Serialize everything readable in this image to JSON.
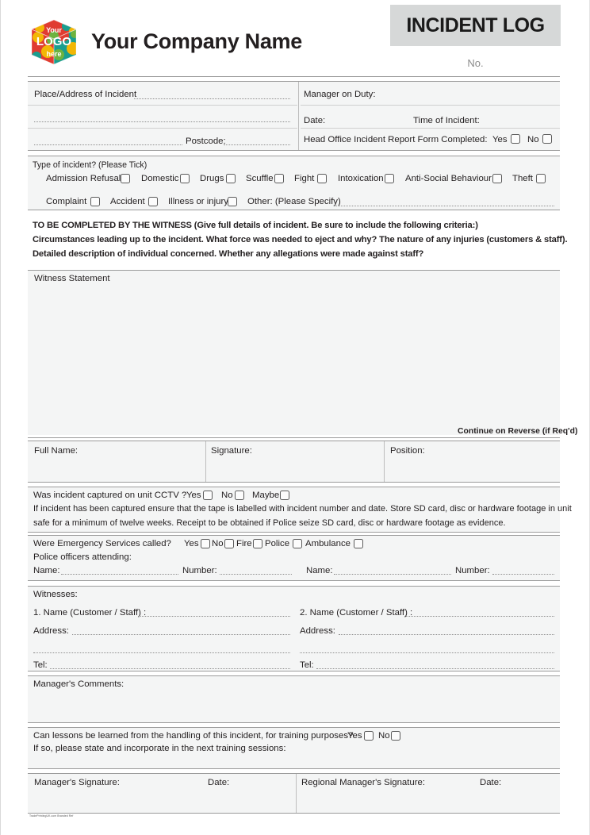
{
  "header": {
    "logo_alt": "Your LOGO here",
    "logo_line1": "Your",
    "logo_line2": "LOGO",
    "logo_line3": "here",
    "company_name": "Your Company Name",
    "doc_title": "INCIDENT LOG",
    "number_label": "No."
  },
  "incident_details": {
    "place_label": "Place/Address of Incident",
    "postcode_label": "Postcode:",
    "manager_on_duty_label": "Manager on Duty:",
    "date_label": "Date:",
    "time_label": "Time of Incident:",
    "head_office_label": "Head Office Incident Report Form Completed:",
    "yes_label": "Yes",
    "no_label": "No"
  },
  "incident_type": {
    "heading": "Type of incident? (Please Tick)",
    "row1": [
      {
        "label": "Admission Refusal"
      },
      {
        "label": "Domestic"
      },
      {
        "label": "Drugs"
      },
      {
        "label": "Scuffle"
      },
      {
        "label": "Fight"
      },
      {
        "label": "Intoxication"
      },
      {
        "label": "Anti-Social Behaviour"
      },
      {
        "label": "Theft"
      }
    ],
    "row2": [
      {
        "label": "Complaint"
      },
      {
        "label": "Accident"
      },
      {
        "label": "Illness or injury"
      }
    ],
    "other_label": "Other: (Please Specify)"
  },
  "witness_instructions": {
    "line1": "TO BE COMPLETED BY THE WITNESS (Give full details of incident. Be sure to include the following criteria:)",
    "line2": "Circumstances leading up to the incident. What force was needed to eject and why? The nature of any injuries (customers & staff).",
    "line3": "Detailed description of individual concerned. Whether any allegations were made against staff?"
  },
  "witness_statement": {
    "label": "Witness Statement",
    "continue_note": "Continue on Reverse (if Req'd)"
  },
  "witness_signoff": {
    "full_name_label": "Full Name:",
    "signature_label": "Signature:",
    "position_label": "Position:"
  },
  "cctv": {
    "question": "Was incident captured on unit CCTV ?",
    "options": [
      "Yes",
      "No",
      "Maybe"
    ],
    "note_line1": "If incident has been captured ensure that the tape is labelled with incident number and date. Store SD card, disc or hardware footage in unit",
    "note_line2": "safe for a minimum of twelve weeks. Receipt to be obtained if Police seize SD card, disc or hardware footage as evidence."
  },
  "emergency_services": {
    "question": "Were Emergency Services called?",
    "options": [
      "Yes",
      "No",
      "Fire",
      "Police",
      "Ambulance"
    ],
    "police_attending_label": "Police officers attending:",
    "name_label": "Name:",
    "number_label": "Number:"
  },
  "witnesses": {
    "heading": "Witnesses:",
    "name1_label": "1. Name (Customer / Staff) :",
    "name2_label": "2. Name (Customer / Staff) :",
    "address_label": "Address:",
    "tel_label": "Tel:"
  },
  "manager_comments": {
    "label": "Manager's Comments:"
  },
  "lessons": {
    "question": "Can lessons be learned from the handling of this incident, for training purposes?",
    "yes_label": "Yes",
    "no_label": "No",
    "followup": "If so, please state and incorporate in the next training sessions:"
  },
  "signatures": {
    "manager_signature_label": "Manager's Signature:",
    "manager_date_label": "Date:",
    "regional_signature_label": "Regional Manager's Signature:",
    "regional_date_label": "Date:"
  },
  "footer": {
    "credit": "TradePrintingUK.com Branded Ref"
  }
}
